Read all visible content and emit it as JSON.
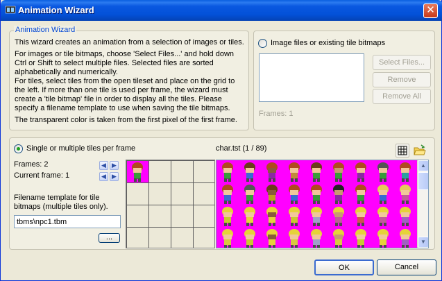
{
  "window": {
    "title": "Animation Wizard",
    "close_glyph": "✕",
    "title_icon": "film-icon"
  },
  "intro": {
    "legend": "Animation Wizard",
    "paragraphs": [
      "This wizard creates an animation from a selection of images or tiles.",
      "For images or tile bitmaps, choose 'Select Files...' and hold down Ctrl or Shift to select multiple files. Selected files are sorted alphabetically and numerically.",
      "For tiles, select tiles from the open tileset and place on the grid to the left. If more than one tile is used per frame, the wizard must create a 'tile bitmap' file in order to display all the tiles. Please specify a filename template to use when saving the tile bitmaps.",
      "The transparent color is taken from the first pixel of the first frame."
    ]
  },
  "image_files": {
    "radio_label": "Image files or existing tile bitmaps",
    "selected": false,
    "select_files_label": "Select Files...",
    "remove_label": "Remove",
    "remove_all_label": "Remove All",
    "frames_label": "Frames: 1"
  },
  "tiles": {
    "radio_label": "Single or multiple tiles per frame",
    "selected": true,
    "frames_label": "Frames: 2",
    "current_frame_label": "Current frame: 1",
    "filename_template_label": "Filename template for tile bitmaps (multiple tiles only).",
    "filename_value": "tbms\\npc1.tbm",
    "browse_label": "...",
    "tileset_caption": "char.tst (1 / 89)",
    "grid_icon": "grid-icon",
    "open_icon": "open-folder-icon"
  },
  "footer": {
    "ok_label": "OK",
    "cancel_label": "Cancel"
  },
  "colors": {
    "titlebar": "#0554e0",
    "tileset_background": "#ff00ff",
    "group_legend": "#0046d5"
  }
}
